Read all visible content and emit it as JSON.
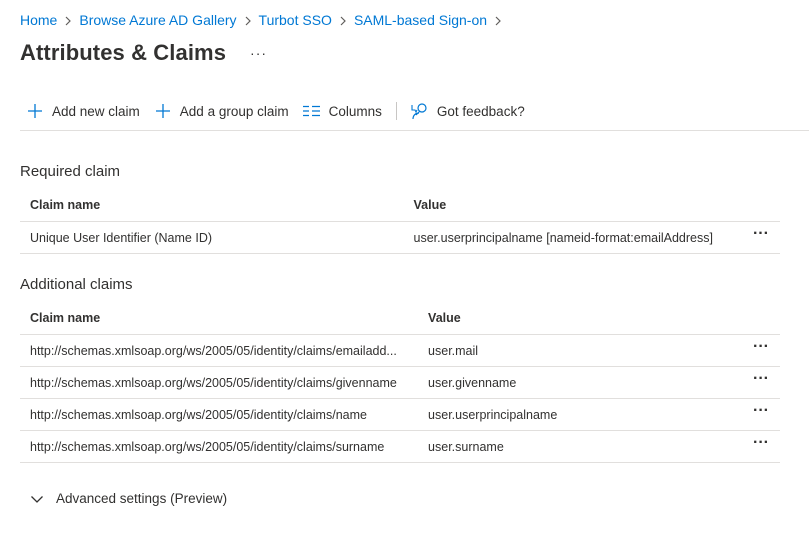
{
  "breadcrumb": {
    "items": [
      "Home",
      "Browse Azure AD Gallery",
      "Turbot SSO",
      "SAML-based Sign-on"
    ]
  },
  "header": {
    "title": "Attributes & Claims",
    "more": "···"
  },
  "toolbar": {
    "add_new_claim": "Add new claim",
    "add_group_claim": "Add a group claim",
    "columns": "Columns",
    "feedback": "Got feedback?"
  },
  "required": {
    "heading": "Required claim",
    "col_name": "Claim name",
    "col_value": "Value",
    "rows": [
      {
        "name": "Unique User Identifier (Name ID)",
        "value": "user.userprincipalname [nameid-format:emailAddress]"
      }
    ]
  },
  "additional": {
    "heading": "Additional claims",
    "col_name": "Claim name",
    "col_value": "Value",
    "rows": [
      {
        "name": "http://schemas.xmlsoap.org/ws/2005/05/identity/claims/emailadd...",
        "value": "user.mail"
      },
      {
        "name": "http://schemas.xmlsoap.org/ws/2005/05/identity/claims/givenname",
        "value": "user.givenname"
      },
      {
        "name": "http://schemas.xmlsoap.org/ws/2005/05/identity/claims/name",
        "value": "user.userprincipalname"
      },
      {
        "name": "http://schemas.xmlsoap.org/ws/2005/05/identity/claims/surname",
        "value": "user.surname"
      }
    ]
  },
  "advanced": {
    "label": "Advanced settings (Preview)"
  },
  "icons": {
    "more": "more-icon",
    "add": "plus-icon",
    "columns": "columns-icon",
    "feedback": "feedback-icon",
    "chevron": "chevron-down-icon"
  },
  "colors": {
    "link": "#0078d4",
    "accent_icon": "#0078d4",
    "text": "#323130",
    "divider": "#e1dfdd"
  }
}
